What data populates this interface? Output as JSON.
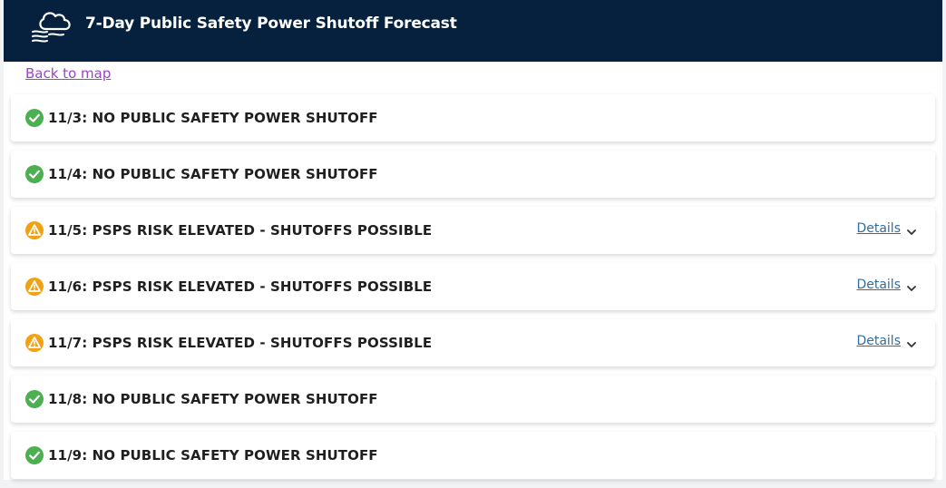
{
  "header": {
    "title": "7-Day Public Safety Power Shutoff Forecast",
    "icon": "cloud-wind-icon"
  },
  "nav": {
    "back_label": "Back to map"
  },
  "colors": {
    "header_bg": "#06213d",
    "ok_green": "#4caf50",
    "warn_orange": "#f0a114",
    "link_purple": "#9a43c9",
    "details_blue": "#2f6ea3"
  },
  "forecast": [
    {
      "label": "11/3: NO PUBLIC SAFETY POWER SHUTOFF",
      "status": "ok",
      "icon": "check-circle-icon"
    },
    {
      "label": "11/4: NO PUBLIC SAFETY POWER SHUTOFF",
      "status": "ok",
      "icon": "check-circle-icon"
    },
    {
      "label": "11/5: PSPS RISK ELEVATED - SHUTOFFS POSSIBLE",
      "status": "elevated",
      "icon": "warning-icon",
      "details_label": "Details"
    },
    {
      "label": "11/6: PSPS RISK ELEVATED - SHUTOFFS POSSIBLE",
      "status": "elevated",
      "icon": "warning-icon",
      "details_label": "Details"
    },
    {
      "label": "11/7: PSPS RISK ELEVATED - SHUTOFFS POSSIBLE",
      "status": "elevated",
      "icon": "warning-icon",
      "details_label": "Details"
    },
    {
      "label": "11/8: NO PUBLIC SAFETY POWER SHUTOFF",
      "status": "ok",
      "icon": "check-circle-icon"
    },
    {
      "label": "11/9: NO PUBLIC SAFETY POWER SHUTOFF",
      "status": "ok",
      "icon": "check-circle-icon"
    }
  ]
}
